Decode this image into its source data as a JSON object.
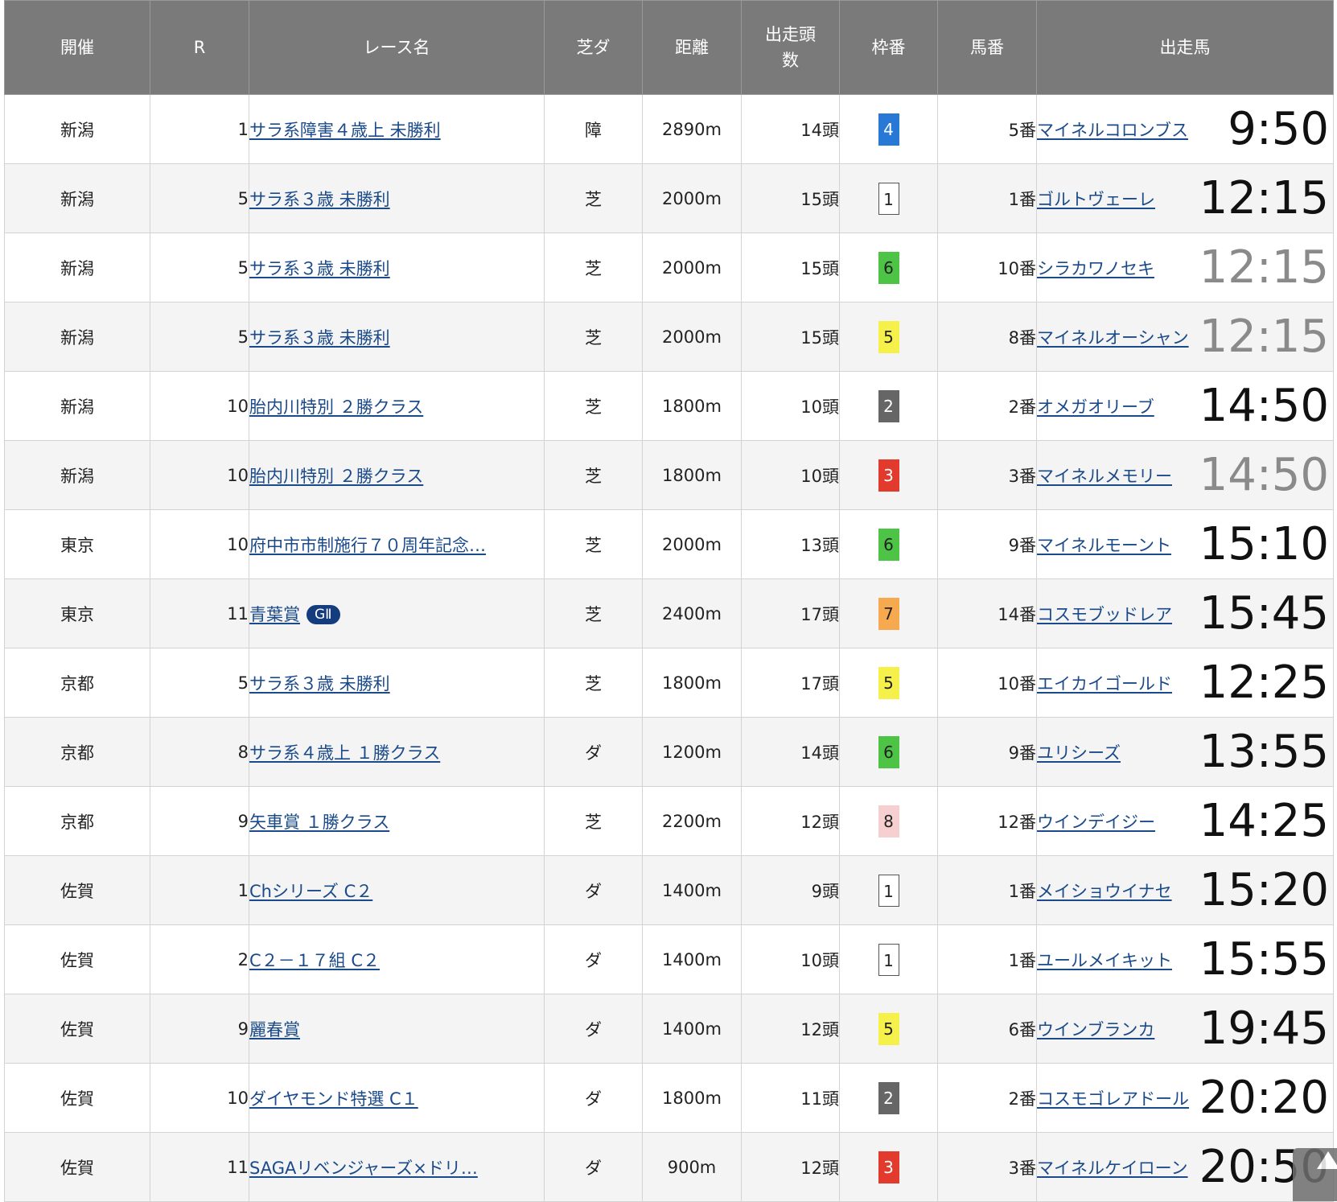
{
  "header": {
    "venue": "開催",
    "race_no": "R",
    "race_name": "レース名",
    "surface": "芝ダ",
    "distance": "距離",
    "field_line1": "出走頭",
    "field_line2": "数",
    "waku": "枠番",
    "umaban": "馬番",
    "horse": "出走馬"
  },
  "rows": [
    {
      "venue": "新潟",
      "r": "1",
      "name": "サラ系障害４歳上 未勝利",
      "grade": "",
      "surface": "障",
      "distance": "2890m",
      "field": "14頭",
      "waku": "4",
      "umaban": "5番",
      "horse": "マイネルコロンブス",
      "time": "9:50",
      "time_style": "dark"
    },
    {
      "venue": "新潟",
      "r": "5",
      "name": "サラ系３歳 未勝利",
      "grade": "",
      "surface": "芝",
      "distance": "2000m",
      "field": "15頭",
      "waku": "1",
      "umaban": "1番",
      "horse": "ゴルトヴェーレ",
      "time": "12:15",
      "time_style": "dark"
    },
    {
      "venue": "新潟",
      "r": "5",
      "name": "サラ系３歳 未勝利",
      "grade": "",
      "surface": "芝",
      "distance": "2000m",
      "field": "15頭",
      "waku": "6",
      "umaban": "10番",
      "horse": "シラカワノセキ",
      "time": "12:15",
      "time_style": "gray"
    },
    {
      "venue": "新潟",
      "r": "5",
      "name": "サラ系３歳 未勝利",
      "grade": "",
      "surface": "芝",
      "distance": "2000m",
      "field": "15頭",
      "waku": "5",
      "umaban": "8番",
      "horse": "マイネルオーシャン",
      "time": "12:15",
      "time_style": "gray"
    },
    {
      "venue": "新潟",
      "r": "10",
      "name": "胎内川特別 ２勝クラス",
      "grade": "",
      "surface": "芝",
      "distance": "1800m",
      "field": "10頭",
      "waku": "2",
      "umaban": "2番",
      "horse": "オメガオリーブ",
      "time": "14:50",
      "time_style": "dark"
    },
    {
      "venue": "新潟",
      "r": "10",
      "name": "胎内川特別 ２勝クラス",
      "grade": "",
      "surface": "芝",
      "distance": "1800m",
      "field": "10頭",
      "waku": "3",
      "umaban": "3番",
      "horse": "マイネルメモリー",
      "time": "14:50",
      "time_style": "gray"
    },
    {
      "venue": "東京",
      "r": "10",
      "name": "府中市市制施行７０周年記念…",
      "grade": "",
      "surface": "芝",
      "distance": "2000m",
      "field": "13頭",
      "waku": "6",
      "umaban": "9番",
      "horse": "マイネルモーント",
      "time": "15:10",
      "time_style": "dark"
    },
    {
      "venue": "東京",
      "r": "11",
      "name": "青葉賞",
      "grade": "GⅡ",
      "surface": "芝",
      "distance": "2400m",
      "field": "17頭",
      "waku": "7",
      "umaban": "14番",
      "horse": "コスモブッドレア",
      "time": "15:45",
      "time_style": "dark"
    },
    {
      "venue": "京都",
      "r": "5",
      "name": "サラ系３歳 未勝利",
      "grade": "",
      "surface": "芝",
      "distance": "1800m",
      "field": "17頭",
      "waku": "5",
      "umaban": "10番",
      "horse": "エイカイゴールド",
      "time": "12:25",
      "time_style": "dark"
    },
    {
      "venue": "京都",
      "r": "8",
      "name": "サラ系４歳上 １勝クラス",
      "grade": "",
      "surface": "ダ",
      "distance": "1200m",
      "field": "14頭",
      "waku": "6",
      "umaban": "9番",
      "horse": "ユリシーズ",
      "time": "13:55",
      "time_style": "dark"
    },
    {
      "venue": "京都",
      "r": "9",
      "name": "矢車賞 １勝クラス",
      "grade": "",
      "surface": "芝",
      "distance": "2200m",
      "field": "12頭",
      "waku": "8",
      "umaban": "12番",
      "horse": "ウインデイジー",
      "time": "14:25",
      "time_style": "dark"
    },
    {
      "venue": "佐賀",
      "r": "1",
      "name": "Chシリーズ C２",
      "grade": "",
      "surface": "ダ",
      "distance": "1400m",
      "field": "9頭",
      "waku": "1",
      "umaban": "1番",
      "horse": "メイショウイナセ",
      "time": "15:20",
      "time_style": "dark"
    },
    {
      "venue": "佐賀",
      "r": "2",
      "name": "C２－１７組 C２",
      "grade": "",
      "surface": "ダ",
      "distance": "1400m",
      "field": "10頭",
      "waku": "1",
      "umaban": "1番",
      "horse": "ユールメイキット",
      "time": "15:55",
      "time_style": "dark"
    },
    {
      "venue": "佐賀",
      "r": "9",
      "name": "麗春賞",
      "grade": "",
      "surface": "ダ",
      "distance": "1400m",
      "field": "12頭",
      "waku": "5",
      "umaban": "6番",
      "horse": "ウインブランカ",
      "time": "19:45",
      "time_style": "dark"
    },
    {
      "venue": "佐賀",
      "r": "10",
      "name": "ダイヤモンド特選 C１",
      "grade": "",
      "surface": "ダ",
      "distance": "1800m",
      "field": "11頭",
      "waku": "2",
      "umaban": "2番",
      "horse": "コスモゴレアドール",
      "time": "20:20",
      "time_style": "dark"
    },
    {
      "venue": "佐賀",
      "r": "11",
      "name": "SAGAリベンジャーズ×ドリ…",
      "grade": "",
      "surface": "ダ",
      "distance": "900m",
      "field": "12頭",
      "waku": "3",
      "umaban": "3番",
      "horse": "マイネルケイローン",
      "time": "20:50",
      "time_style": "dark"
    }
  ],
  "colors": {
    "header_bg": "#7a7a7a",
    "link": "#1a4a8a",
    "grade_badge": "#163c80",
    "waku_1": "#ffffff",
    "waku_2": "#666666",
    "waku_3": "#e23b2e",
    "waku_4": "#2879d6",
    "waku_5": "#f6f04a",
    "waku_6": "#4ec447",
    "waku_7": "#f7a94f",
    "waku_8": "#f6cfd0"
  },
  "scroll_top_icon": "arrow-up-icon"
}
